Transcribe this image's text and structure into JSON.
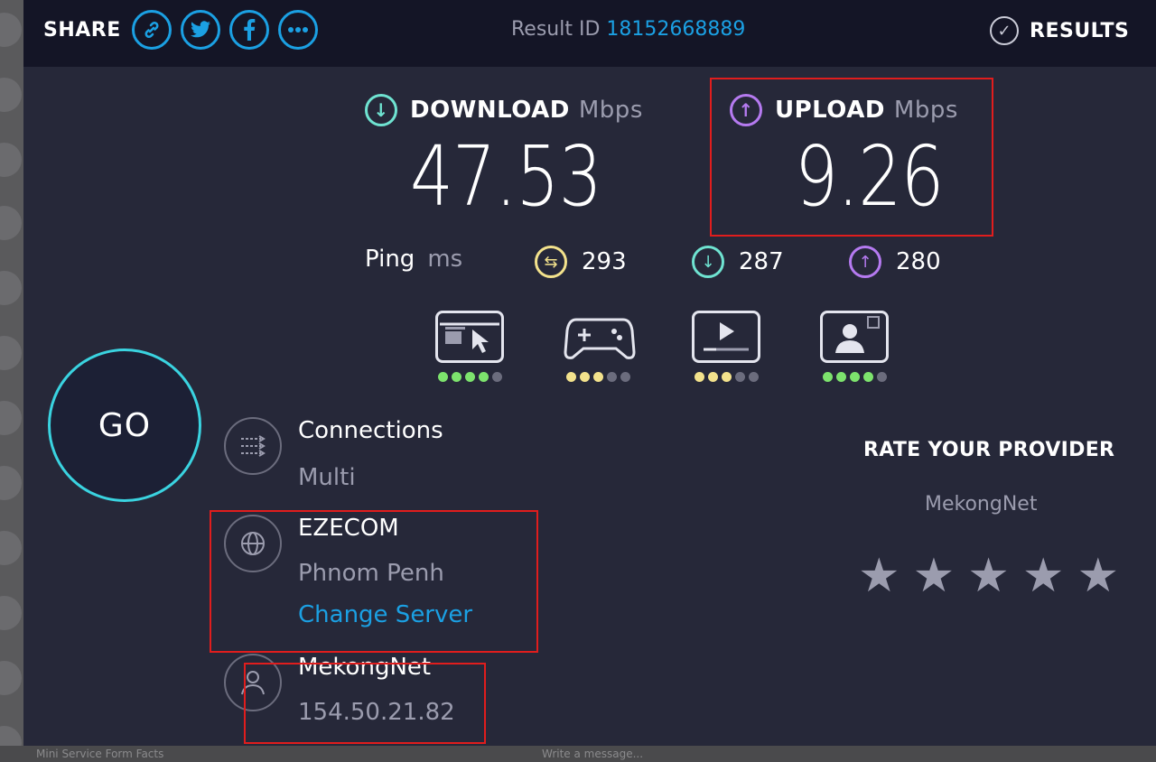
{
  "share": {
    "label": "SHARE",
    "icons": [
      "link-icon",
      "twitter-icon",
      "facebook-icon",
      "more-icon"
    ]
  },
  "result": {
    "label": "Result ID",
    "id": "18152668889"
  },
  "results_button": {
    "label": "RESULTS",
    "icon": "check-circle-icon"
  },
  "download": {
    "label": "DOWNLOAD",
    "unit": "Mbps",
    "value": "47.53",
    "color": "#6fe3d1"
  },
  "upload": {
    "label": "UPLOAD",
    "unit": "Mbps",
    "value": "9.26",
    "color": "#b57af0"
  },
  "ping": {
    "label": "Ping",
    "unit": "ms",
    "idle": "293",
    "download": "287",
    "upload": "280"
  },
  "quality": [
    {
      "name": "browsing",
      "icon": "browser-cursor-icon",
      "rating": 4,
      "max": 5,
      "color": "#7de36d"
    },
    {
      "name": "gaming",
      "icon": "gamepad-icon",
      "rating": 3,
      "max": 5,
      "color": "#f3e28c"
    },
    {
      "name": "streaming",
      "icon": "video-player-icon",
      "rating": 3,
      "max": 5,
      "color": "#f3e28c"
    },
    {
      "name": "video-chat",
      "icon": "video-call-icon",
      "rating": 4,
      "max": 5,
      "color": "#7de36d"
    }
  ],
  "go_label": "GO",
  "connections": {
    "title": "Connections",
    "value": "Multi"
  },
  "server": {
    "name": "EZECOM",
    "location": "Phnom Penh",
    "change_label": "Change Server"
  },
  "isp": {
    "name": "MekongNet",
    "ip": "154.50.21.82"
  },
  "rate": {
    "title": "RATE YOUR PROVIDER",
    "provider": "MekongNet",
    "stars": 5
  },
  "background": {
    "bottom_left": "Mini Service Form Facts",
    "bottom_right": "Write a message..."
  },
  "colors": {
    "accent": "#1ba0e3",
    "background": "#262839",
    "topbar": "#141526",
    "highlight": "#e01d1d"
  }
}
